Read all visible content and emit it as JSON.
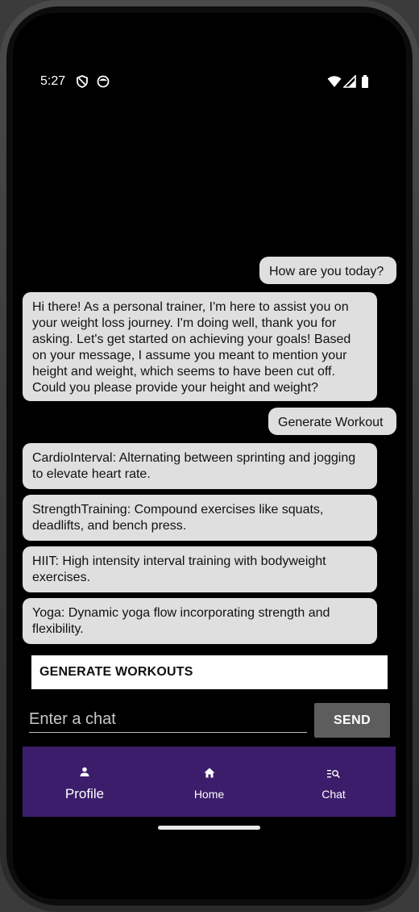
{
  "status_bar": {
    "time": "5:27",
    "icons_left": [
      "shield-icon",
      "face-icon"
    ],
    "icons_right": [
      "wifi-icon",
      "signal-icon",
      "battery-icon"
    ]
  },
  "chat": {
    "messages": [
      {
        "role": "user",
        "text": "How are you today?"
      },
      {
        "role": "assistant",
        "text": "Hi there! As a personal trainer, I'm here to assist you on your weight loss journey. I'm doing well, thank you for asking. Let's get started on achieving your goals! Based on your message, I assume you meant to mention your height and weight, which seems to have been cut off. Could you please provide your height and weight?"
      },
      {
        "role": "user",
        "text": "Generate Workout"
      },
      {
        "role": "assistant",
        "text": "CardioInterval: Alternating between sprinting and jogging to elevate heart rate."
      },
      {
        "role": "assistant",
        "text": "StrengthTraining: Compound exercises like squats, deadlifts, and bench press."
      },
      {
        "role": "assistant",
        "text": "HIIT: High intensity interval training with bodyweight exercises."
      },
      {
        "role": "assistant",
        "text": "Yoga: Dynamic yoga flow incorporating strength and flexibility."
      }
    ]
  },
  "generate_button": {
    "label": "GENERATE WORKOUTS"
  },
  "chat_input": {
    "placeholder": "Enter a chat",
    "value": ""
  },
  "send_button": {
    "label": "SEND"
  },
  "bottom_nav": {
    "items": [
      {
        "label": "Profile",
        "icon": "person-icon"
      },
      {
        "label": "Home",
        "icon": "home-icon"
      },
      {
        "label": "Chat",
        "icon": "search-list-icon"
      }
    ]
  },
  "colors": {
    "background": "#000000",
    "bubble": "#e0dfdf",
    "nav": "#3c1d6b",
    "send_button": "#5d5d5d"
  }
}
